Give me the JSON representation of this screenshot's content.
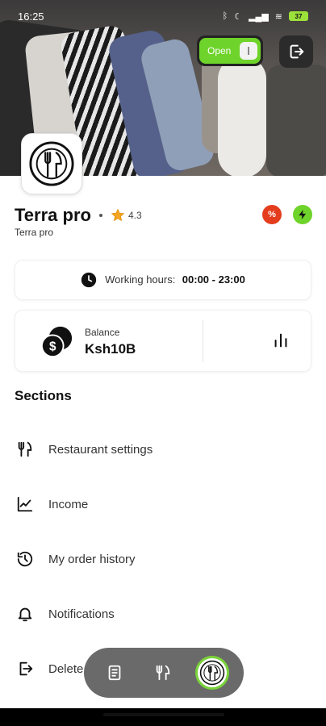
{
  "status_bar": {
    "time": "16:25",
    "battery": "37"
  },
  "header": {
    "open_toggle_label": "Open"
  },
  "restaurant": {
    "name": "Terra pro",
    "subtitle": "Terra pro",
    "rating": "4.3",
    "discount_badge": "%"
  },
  "working_hours": {
    "label": "Working hours:",
    "value": "00:00 - 23:00"
  },
  "balance": {
    "label": "Balance",
    "value": "Ksh10B"
  },
  "sections": {
    "title": "Sections",
    "items": [
      {
        "label": "Restaurant settings",
        "icon": "fork-knife-icon"
      },
      {
        "label": "Income",
        "icon": "chart-line-icon"
      },
      {
        "label": "My order history",
        "icon": "history-icon"
      },
      {
        "label": "Notifications",
        "icon": "bell-icon"
      },
      {
        "label": "Delete",
        "icon": "logout-box-icon"
      }
    ]
  },
  "colors": {
    "accent": "#6ed32a",
    "danger": "#e43d1d",
    "nav": "#6a6a6a"
  }
}
